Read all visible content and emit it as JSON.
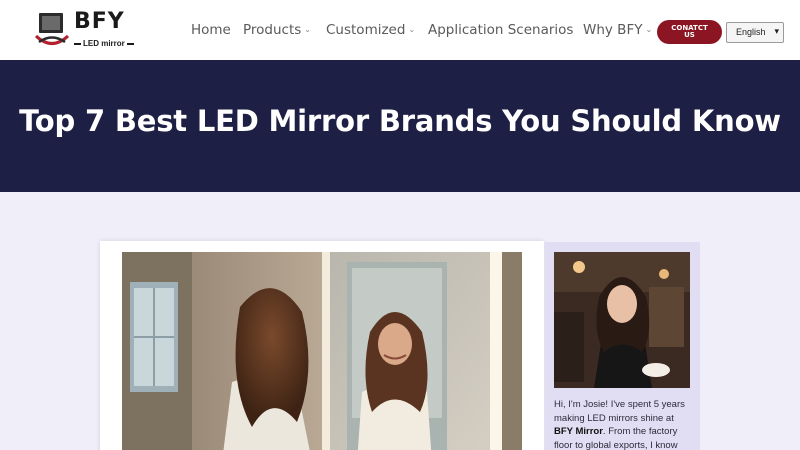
{
  "header": {
    "logo": {
      "name": "BFY",
      "tagline": "LED mirror"
    },
    "nav": [
      {
        "label": "Home",
        "has_dropdown": false
      },
      {
        "label": "Products",
        "has_dropdown": true
      },
      {
        "label": "Customized",
        "has_dropdown": true
      },
      {
        "label": "Application Scenarios",
        "has_dropdown": false
      },
      {
        "label": "Why BFY",
        "has_dropdown": true
      }
    ],
    "contact_button": {
      "line1": "CONATCT",
      "line2": "US"
    },
    "language_select": {
      "value": "English"
    }
  },
  "hero": {
    "title": "Top 7 Best LED Mirror Brands You Should Know"
  },
  "author": {
    "bio_intro": "Hi, I'm Josie! I've spent 5 years making LED mirrors shine at ",
    "bio_brand": "BFY Mirror",
    "bio_rest": ". From the factory floor to global exports, I know what it"
  },
  "colors": {
    "hero_bg": "#1e1f45",
    "contact_button": "#8b1522",
    "page_bg": "#f0eff9",
    "author_card_bg": "#e1ddf2"
  },
  "icons": {
    "logo": "mirror-stand-logo-icon",
    "dropdown": "chevron-down-icon"
  }
}
